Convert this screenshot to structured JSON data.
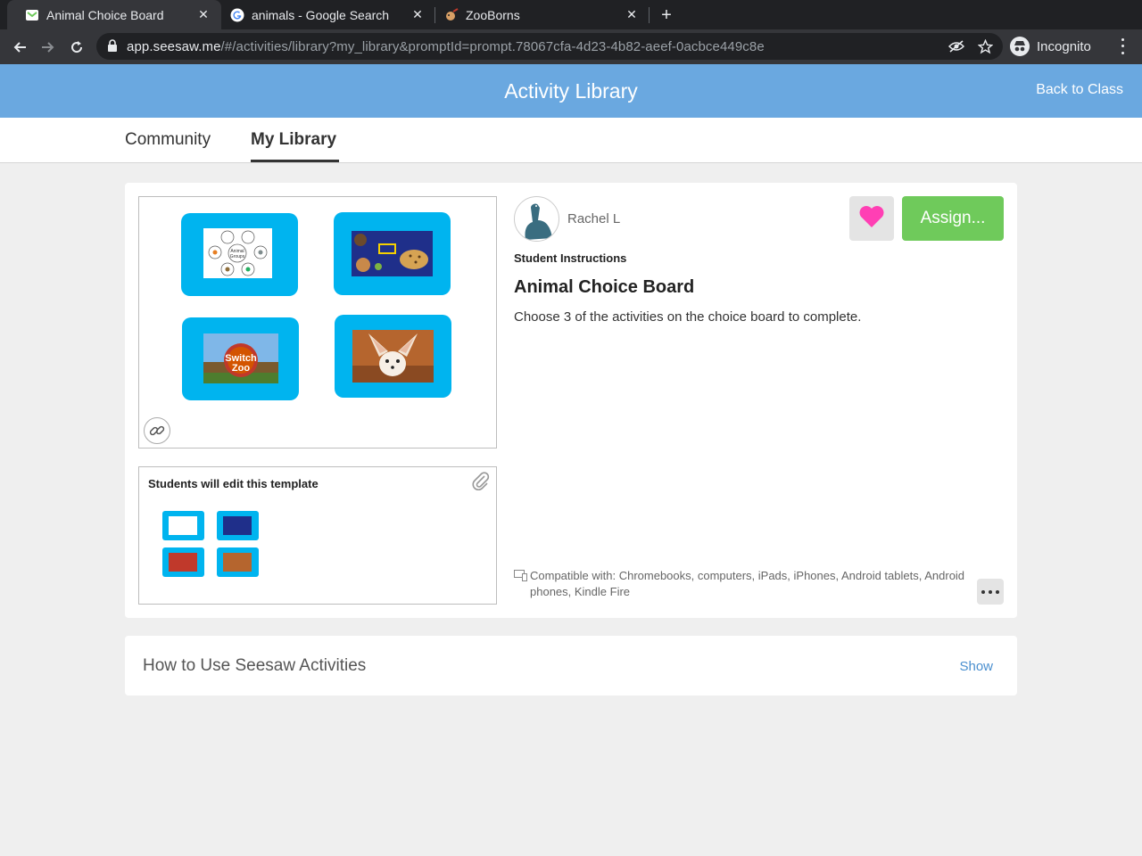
{
  "browser": {
    "tabs": [
      {
        "title": "Animal Choice Board",
        "active": true,
        "favicon": "seesaw-icon"
      },
      {
        "title": "animals - Google Search",
        "active": false,
        "favicon": "google-icon"
      },
      {
        "title": "ZooBorns",
        "active": false,
        "favicon": "zooborns-icon"
      }
    ],
    "close_glyph": "✕",
    "new_tab_glyph": "+",
    "url_host": "app.seesaw.me",
    "url_path": "/#/activities/library?my_library&promptId=prompt.78067cfa-4d23-4b82-aeef-0acbce449c8e",
    "incognito_label": "Incognito"
  },
  "header": {
    "title": "Activity Library",
    "back_label": "Back to Class"
  },
  "library_tabs": {
    "community": "Community",
    "my_library": "My Library"
  },
  "activity": {
    "author": "Rachel L",
    "instructions_label": "Student Instructions",
    "title": "Animal Choice Board",
    "description": "Choose 3 of the activities on the choice board to complete.",
    "assign_label": "Assign...",
    "template_label": "Students will edit this template",
    "compatible_text": "Compatible with: Chromebooks, computers, iPads, iPhones, Android tablets, Android phones, Kindle Fire",
    "preview_tiles": [
      "animal-groups-image",
      "national-geographic-kids-image",
      "switch-zoo-image",
      "fennec-fox-image"
    ],
    "heart_color": "#ff3fb4",
    "assign_color": "#6fca5b"
  },
  "howto": {
    "title": "How to Use Seesaw Activities",
    "show_label": "Show"
  }
}
